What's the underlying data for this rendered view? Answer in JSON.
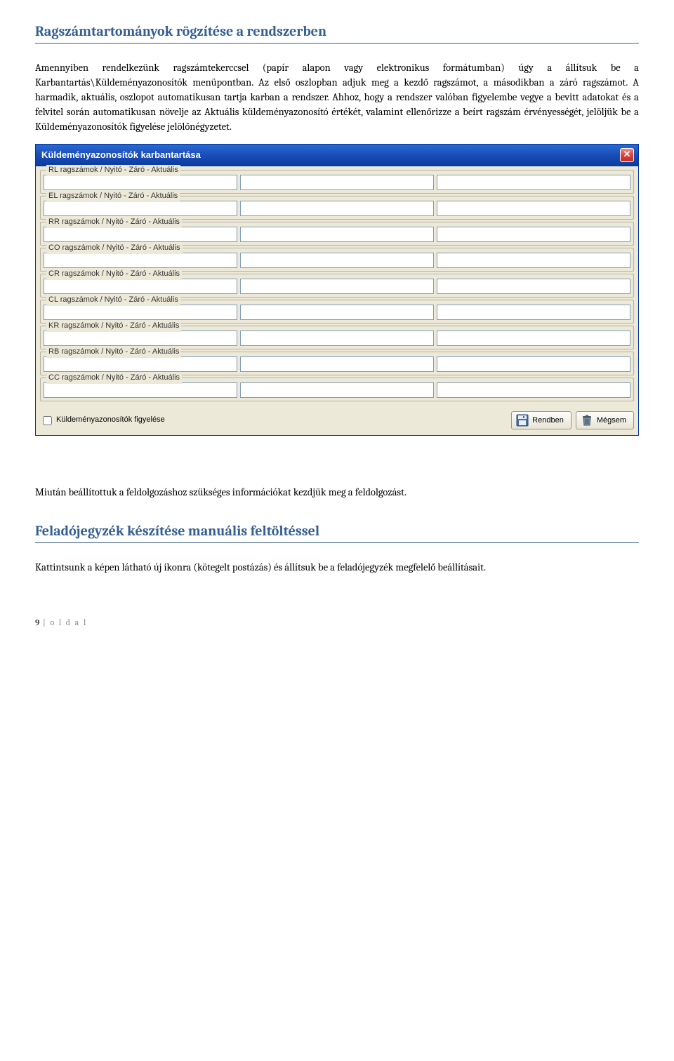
{
  "heading1": "Ragszámtartományok rögzítése a rendszerben",
  "para1": "Amennyiben rendelkezünk ragszámtekerccsel (papír alapon vagy elektronikus formátumban) úgy a állítsuk be a Karbantartás\\Küldeményazonosítók menüpontban. Az első oszlopban adjuk meg a kezdő ragszámot, a másodikban a záró ragszámot. A harmadik, aktuális, oszlopot automatikusan tartja karban a rendszer. Ahhoz, hogy a rendszer valóban figyelembe vegye a bevitt adatokat és a felvitel során automatikusan növelje az Aktuális küldeményazonosító értékét, valamint ellenőrizze a beírt ragszám érvényességét, jelöljük be a Küldeményazonosítók figyelése jelölőnégyzetet.",
  "dialog": {
    "title": "Küldeményazonosítók karbantartása",
    "groups": [
      {
        "label": "RL ragszámok / Nyitó - Záró - Aktuális"
      },
      {
        "label": "EL ragszámok / Nyitó - Záró - Aktuális"
      },
      {
        "label": "RR ragszámok / Nyitó - Záró - Aktuális"
      },
      {
        "label": "CO ragszámok / Nyitó - Záró - Aktuális"
      },
      {
        "label": "CR ragszámok / Nyitó - Záró - Aktuális"
      },
      {
        "label": "CL ragszámok / Nyitó - Záró - Aktuális"
      },
      {
        "label": "KR ragszámok / Nyitó - Záró - Aktuális"
      },
      {
        "label": "RB ragszámok / Nyitó - Záró - Aktuális"
      },
      {
        "label": "CC ragszámok / Nyitó - Záró - Aktuális"
      }
    ],
    "checkbox_label": "Küldeményazonosítók figyelése",
    "ok_label": "Rendben",
    "cancel_label": "Mégsem"
  },
  "para2": "Miután beállítottuk a feldolgozáshoz szükséges információkat kezdjük meg a feldolgozást.",
  "heading2": "Feladójegyzék készítése manuális feltöltéssel",
  "para3": "Kattintsunk a képen látható új ikonra (kötegelt postázás) és állítsuk be a feladójegyzék megfelelő beállításait.",
  "footer": {
    "num": "9",
    "text": " | o l d a l"
  }
}
